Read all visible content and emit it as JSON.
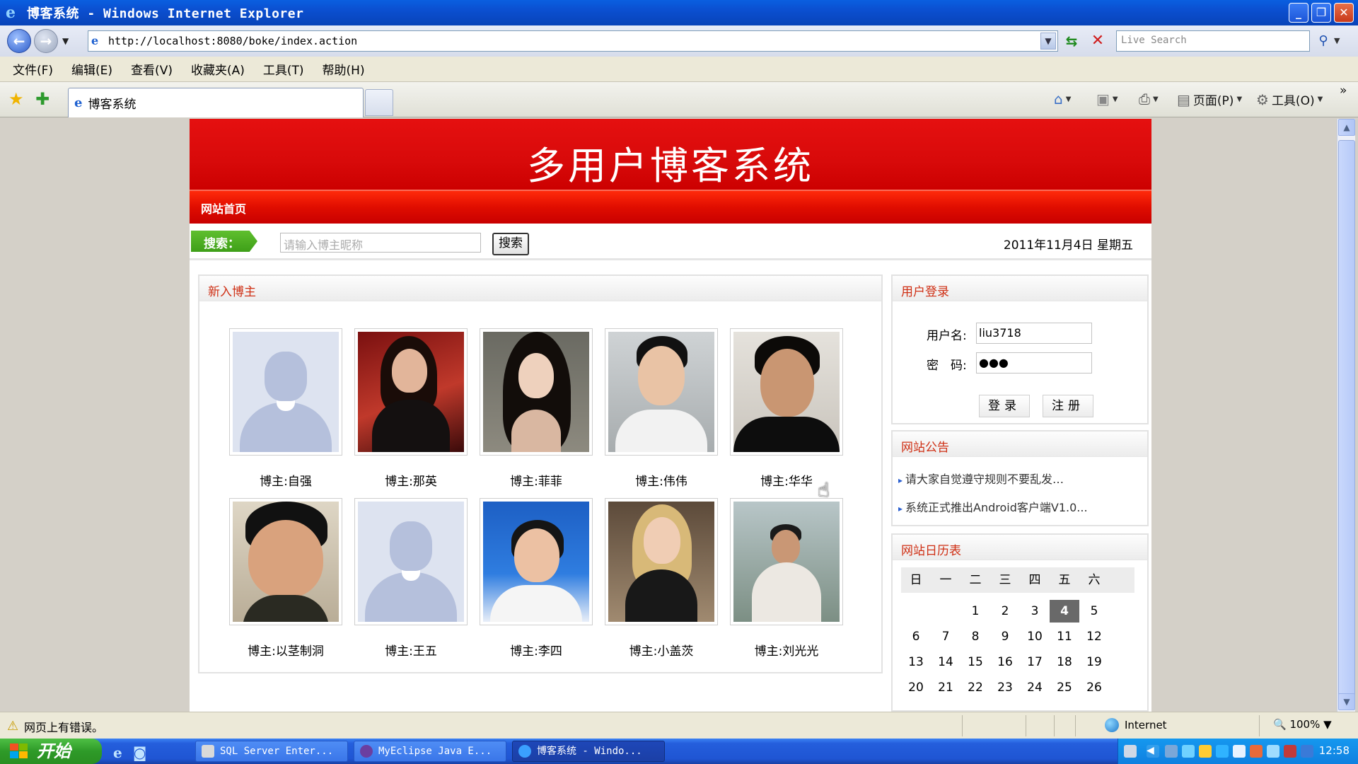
{
  "window": {
    "title": "博客系统 - Windows Internet Explorer",
    "minimize": "_",
    "maximize": "❐",
    "close": "✕"
  },
  "addressbar": {
    "url": "http://localhost:8080/boke/index.action",
    "search_placeholder": "Live Search"
  },
  "menubar": {
    "items": [
      "文件(F)",
      "编辑(E)",
      "查看(V)",
      "收藏夹(A)",
      "工具(T)",
      "帮助(H)"
    ]
  },
  "tabbar": {
    "active_tab": "博客系统",
    "page_cmd": "页面(P)",
    "tools_cmd": "工具(O)"
  },
  "site": {
    "banner_title": "多用户博客系统",
    "nav_home": "网站首页",
    "search_label": "搜索：",
    "search_placeholder": "请输入博主昵称",
    "search_button": "搜索",
    "date": "2011年11月4日 星期五"
  },
  "bloggers": {
    "heading": "新入博主",
    "items": [
      {
        "name": "博主:自强",
        "avatar": "placeholder-avatar"
      },
      {
        "name": "博主:那英",
        "avatar": "photo"
      },
      {
        "name": "博主:菲菲",
        "avatar": "photo"
      },
      {
        "name": "博主:伟伟",
        "avatar": "photo"
      },
      {
        "name": "博主:华华",
        "avatar": "photo"
      },
      {
        "name": "博主:以茎制洞",
        "avatar": "photo"
      },
      {
        "name": "博主:王五",
        "avatar": "placeholder-avatar"
      },
      {
        "name": "博主:李四",
        "avatar": "photo"
      },
      {
        "name": "博主:小盖茨",
        "avatar": "photo"
      },
      {
        "name": "博主:刘光光",
        "avatar": "photo"
      }
    ]
  },
  "login": {
    "heading": "用户登录",
    "username_label": "用户名:",
    "username_value": "liu3718",
    "password_label": "密　码:",
    "password_value": "●●●",
    "login_button": "登录",
    "register_button": "注册"
  },
  "notice": {
    "heading": "网站公告",
    "items": [
      "请大家自觉遵守规则不要乱发…",
      "系统正式推出Android客户端V1.0..."
    ]
  },
  "calendar": {
    "heading": "网站日历表",
    "weekdays": [
      "日",
      "一",
      "二",
      "三",
      "四",
      "五",
      "六"
    ],
    "days": [
      "1",
      "2",
      "3",
      "4",
      "5",
      "6",
      "7",
      "8",
      "9",
      "10",
      "11",
      "12",
      "13",
      "14",
      "15",
      "16",
      "17",
      "18",
      "19",
      "20",
      "21",
      "22",
      "23",
      "24",
      "25",
      "26"
    ],
    "first_weekday_index": 2,
    "today": "4"
  },
  "statusbar": {
    "message": "网页上有错误。",
    "zone": "Internet",
    "zoom": "100%"
  },
  "taskbar": {
    "start": "开始",
    "tasks": [
      "SQL Server Enter...",
      "MyEclipse Java E...",
      "博客系统 - Windo..."
    ],
    "clock": "12:58"
  },
  "colors": {
    "banner_red": "#d80a0a",
    "accent_green": "#4caf20",
    "panel_heading": "#cf2f14",
    "today_bg": "#696969"
  }
}
